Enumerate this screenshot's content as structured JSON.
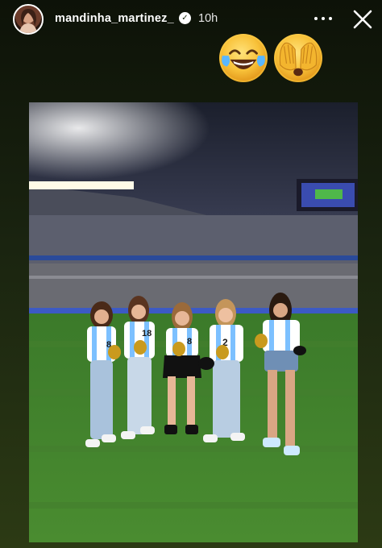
{
  "header": {
    "username": "mandinha_martinez_",
    "verified_icon": "verified-badge-icon",
    "time_ago": "10h",
    "more_icon": "more-horizontal-icon",
    "close_icon": "close-icon"
  },
  "stickers": [
    {
      "icon": "face-with-tears-of-joy-emoji"
    },
    {
      "icon": "face-with-hands-over-eyes-emoji"
    }
  ],
  "photo": {
    "jerseys": [
      "8",
      "18",
      "8",
      "2",
      ""
    ]
  },
  "colors": {
    "background_top": "#0d1208",
    "background_bottom": "#2c3a14",
    "text": "#ffffff",
    "emoji_yellow": "#f8c23a"
  }
}
